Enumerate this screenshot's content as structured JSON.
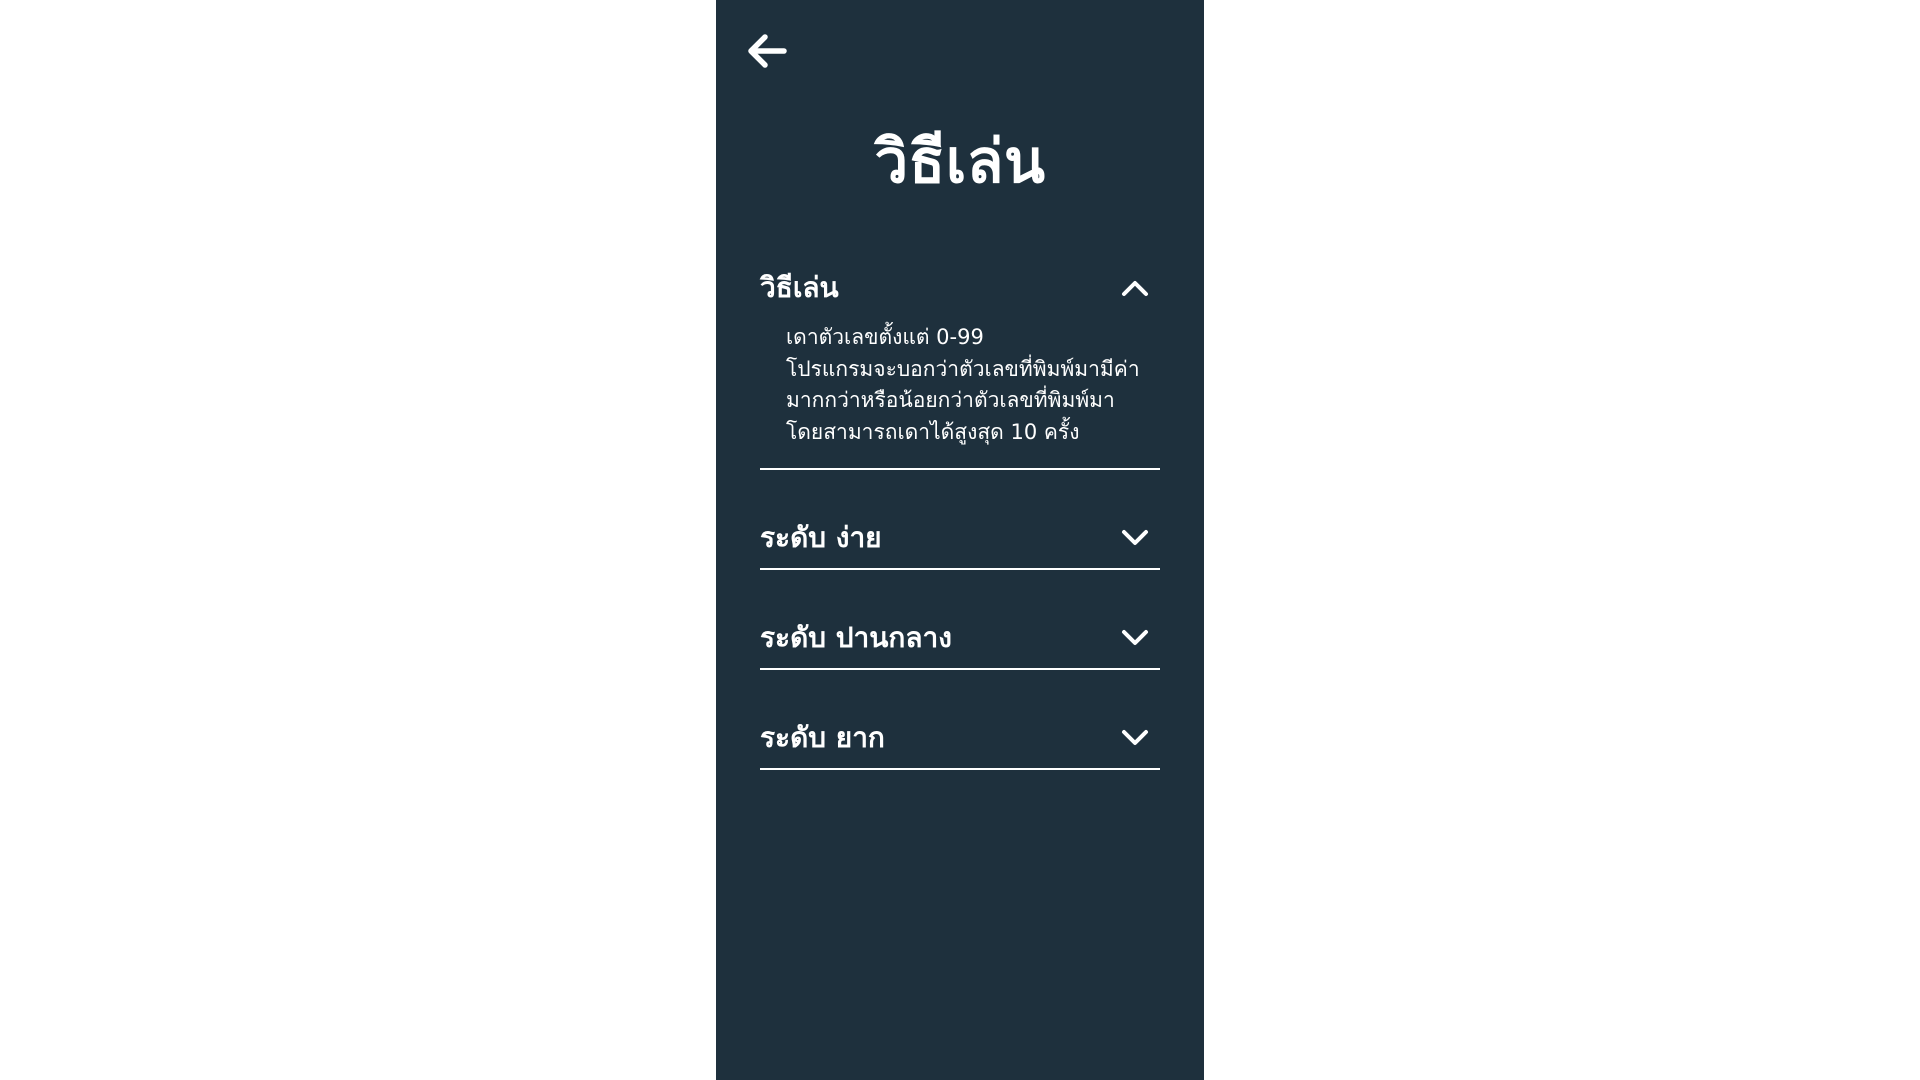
{
  "app": {
    "background_color": "#ffffff",
    "panel_color": "#1e303d",
    "text_color": "#ffffff"
  },
  "header": {
    "back_icon": "arrow-left-icon",
    "title": "วิธีเล่น"
  },
  "accordion": {
    "items": [
      {
        "title": "วิธีเล่น",
        "expanded": true,
        "icon": "chevron-up-icon",
        "body_lines": [
          "เดาตัวเลขตั้งแต่ 0-99",
          "โปรแกรมจะบอกว่าตัวเลขที่พิมพ์มามีค่า",
          "มากกว่าหรือน้อยกว่าตัวเลขที่พิมพ์มา",
          "โดยสามารถเดาได้สูงสุด 10 ครั้ง"
        ]
      },
      {
        "title": "ระดับ ง่าย",
        "expanded": false,
        "icon": "chevron-down-icon"
      },
      {
        "title": "ระดับ ปานกลาง",
        "expanded": false,
        "icon": "chevron-down-icon"
      },
      {
        "title": "ระดับ ยาก",
        "expanded": false,
        "icon": "chevron-down-icon"
      }
    ]
  }
}
